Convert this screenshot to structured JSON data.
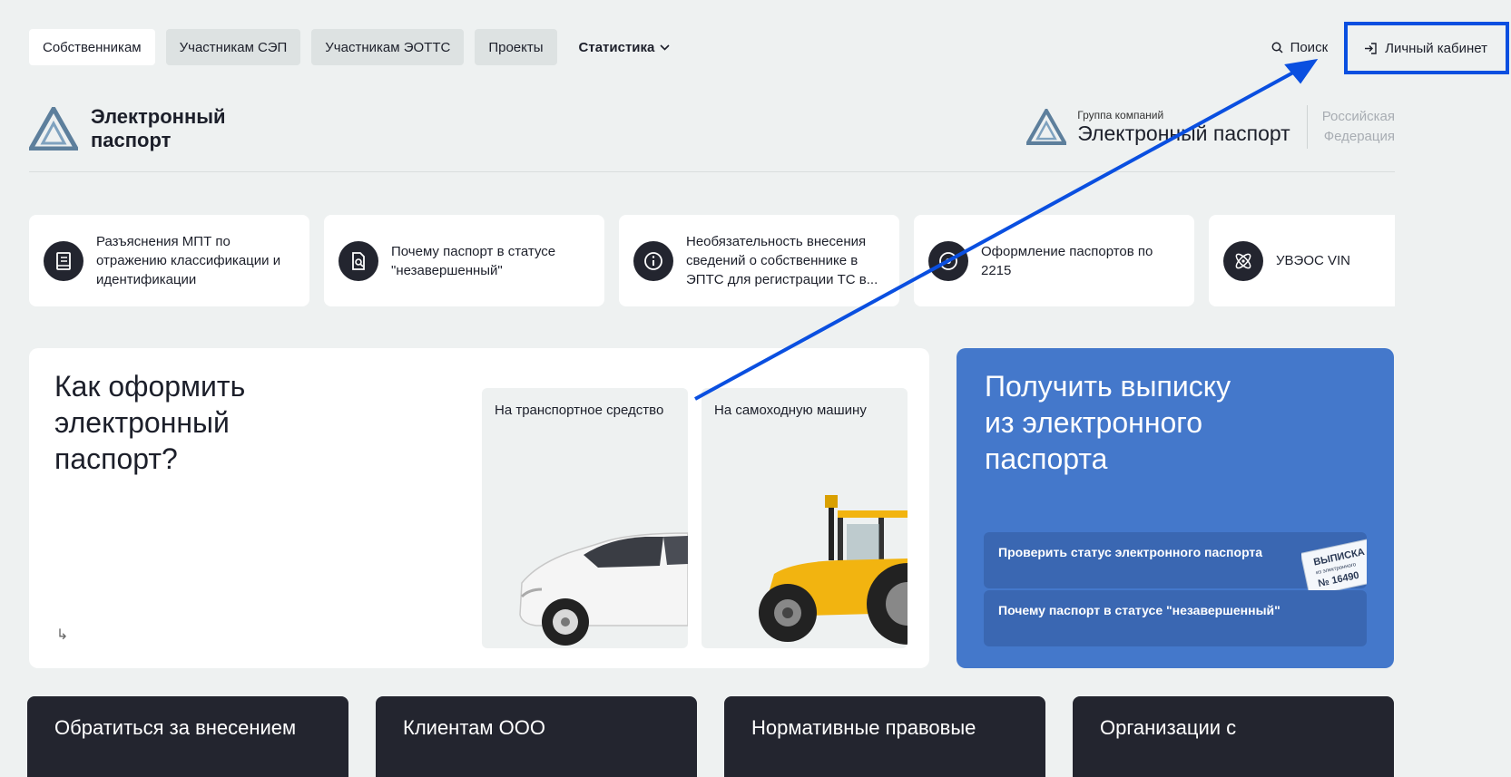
{
  "nav": {
    "items": [
      "Собственникам",
      "Участникам СЭП",
      "Участникам ЭОТТС",
      "Проекты"
    ],
    "stats_label": "Статистика",
    "search_label": "Поиск",
    "cabinet_label": "Личный кабинет"
  },
  "header": {
    "logo_line1": "Электронный",
    "logo_line2": "паспорт",
    "group_small": "Группа компаний",
    "group_big": "Электронный паспорт",
    "region_line1": "Российская",
    "region_line2": "Федерация"
  },
  "quick": [
    {
      "text": "Разъяснения МПТ по отражению классификации и идентификации",
      "icon": "book-icon"
    },
    {
      "text": "Почему паспорт в статусе \"незавершенный\"",
      "icon": "doc-search-icon"
    },
    {
      "text": "Необязательность внесения сведений о собственнике в ЭПТС для регистрации ТС в...",
      "icon": "info-icon"
    },
    {
      "text": "Оформление паспортов по 2215",
      "icon": "target-icon"
    },
    {
      "text": "УВЭОС VIN",
      "icon": "atom-icon"
    }
  ],
  "howto": {
    "title": "Как оформить электронный паспорт?",
    "arrow": "↳",
    "vehicle_car": "На транспортное средство",
    "vehicle_tractor": "На самоходную машину"
  },
  "blue": {
    "title": "Получить выписку из электронного паспорта",
    "btn1": "Проверить статус электронного паспорта",
    "btn2": "Почему паспорт в статусе \"незавершенный\"",
    "stamp_line1": "ВЫПИСКА",
    "stamp_line2": "из электронного",
    "stamp_line3": "№ 16490"
  },
  "bottom": [
    "Обратиться за внесением",
    "Клиентам ООО",
    "Нормативные правовые",
    "Организации с"
  ],
  "colors": {
    "accent_blue": "#4478cb",
    "dark": "#23252f",
    "annotation": "#0a4fe0"
  }
}
